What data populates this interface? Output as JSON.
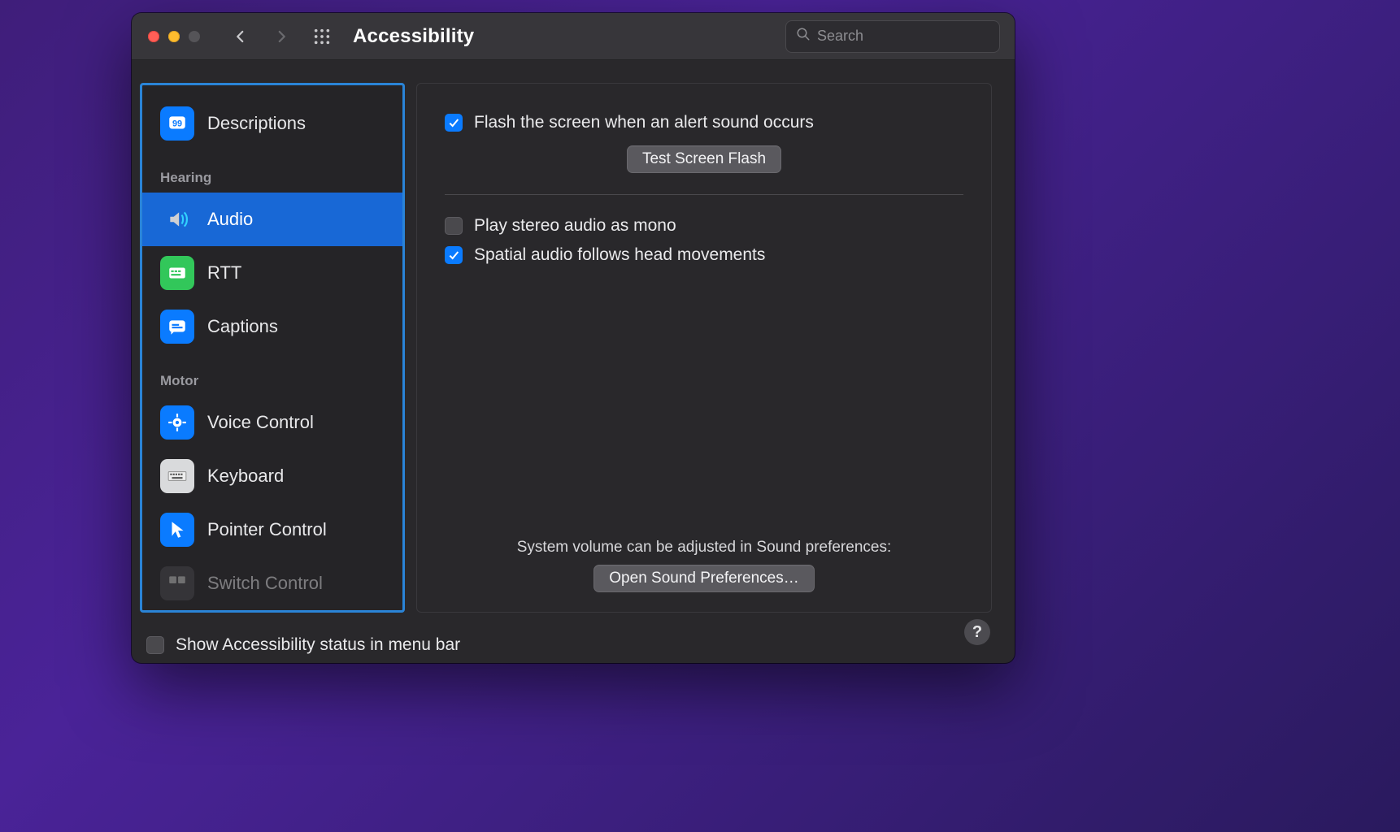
{
  "window": {
    "title": "Accessibility"
  },
  "search": {
    "placeholder": "Search"
  },
  "sidebar": {
    "items": [
      {
        "label": "Descriptions"
      }
    ],
    "hearing_header": "Hearing",
    "hearing": [
      {
        "label": "Audio"
      },
      {
        "label": "RTT"
      },
      {
        "label": "Captions"
      }
    ],
    "motor_header": "Motor",
    "motor": [
      {
        "label": "Voice Control"
      },
      {
        "label": "Keyboard"
      },
      {
        "label": "Pointer Control"
      },
      {
        "label": "Switch Control"
      }
    ]
  },
  "detail": {
    "flash_label": "Flash the screen when an alert sound occurs",
    "test_button": "Test Screen Flash",
    "mono_label": "Play stereo audio as mono",
    "spatial_label": "Spatial audio follows head movements",
    "volume_note": "System volume can be adjusted in Sound preferences:",
    "open_sound_button": "Open Sound Preferences…"
  },
  "footer": {
    "menu_bar_label": "Show Accessibility status in menu bar",
    "help": "?"
  }
}
